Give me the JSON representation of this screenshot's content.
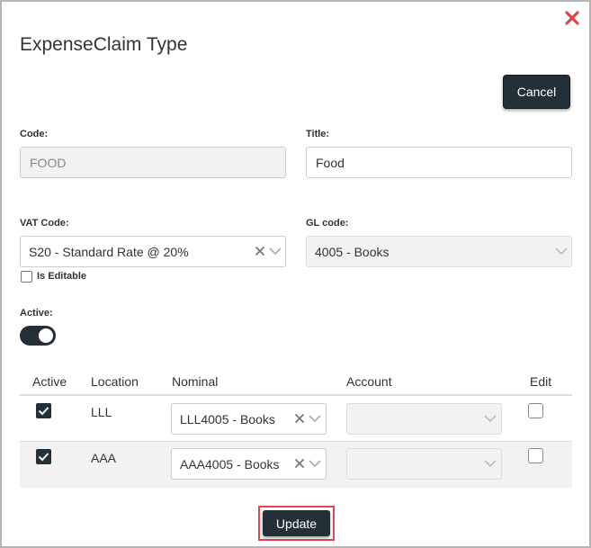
{
  "dialog": {
    "title": "ExpenseClaim Type",
    "close_icon": "close-icon",
    "cancel_label": "Cancel",
    "update_label": "Update"
  },
  "form": {
    "code_label": "Code:",
    "code_value": "FOOD",
    "title_label": "Title:",
    "title_value": "Food",
    "vat_label": "VAT Code:",
    "vat_value": "S20 - Standard Rate @ 20%",
    "gl_label": "GL code:",
    "gl_value": "4005 - Books",
    "is_editable_label": "Is Editable",
    "is_editable_checked": false,
    "active_label": "Active:",
    "active_on": true
  },
  "table": {
    "headers": {
      "active": "Active",
      "location": "Location",
      "nominal": "Nominal",
      "account": "Account",
      "edit": "Edit"
    },
    "rows": [
      {
        "active": true,
        "location": "LLL",
        "nominal": "LLL4005 - Books",
        "account": "",
        "edit": false
      },
      {
        "active": true,
        "location": "AAA",
        "nominal": "AAA4005 - Books",
        "account": "",
        "edit": false
      }
    ]
  },
  "colors": {
    "primary_dark": "#243038",
    "close_red": "#e0474c",
    "highlight_red": "#e0474c"
  }
}
